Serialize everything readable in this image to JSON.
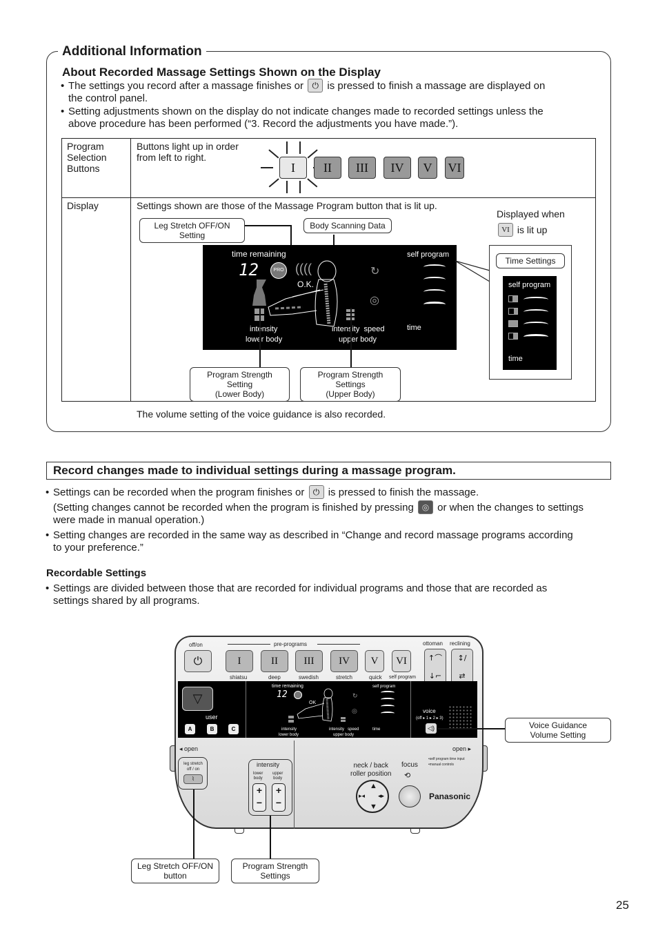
{
  "additional_info": {
    "title": "Additional Information",
    "subtitle": "About Recorded Massage Settings Shown on the Display",
    "bullets": [
      {
        "before": "The settings you record after a massage finishes or",
        "icon": "power-icon",
        "after": "is pressed to finish a massage are displayed on",
        "cont": "the control panel."
      },
      {
        "line1": "Setting adjustments shown on the display do not indicate changes made to recorded settings unless the",
        "line2": "above procedure has been performed (“3. Record the adjustments you have made.”)."
      }
    ],
    "table": {
      "rows": [
        {
          "label": [
            "Program",
            "Selection",
            "Buttons"
          ],
          "desc": [
            "Buttons light up in order",
            "from left to right."
          ]
        },
        {
          "label": [
            "Display"
          ],
          "desc": [
            "Settings shown are those of the Massage Program button that is lit up."
          ]
        }
      ],
      "program_buttons": [
        "I",
        "II",
        "III",
        "IV",
        "V",
        "VI"
      ],
      "lit_button_index": 0,
      "callouts": {
        "leg_stretch": "Leg Stretch OFF/ON Setting",
        "body_scan": "Body Scanning Data",
        "strength_lower": [
          "Program Strength Setting",
          "(Lower Body)"
        ],
        "strength_upper": [
          "Program Strength Settings",
          "(Upper Body)"
        ],
        "time_settings": "Time Settings"
      },
      "displayed_when": {
        "line1": "Displayed when",
        "button": "VI",
        "after": "is lit up"
      },
      "lcd": {
        "time_remaining": "time remaining",
        "time_value": "12",
        "pro": "PRO",
        "ok": "O.K.",
        "self_program": "self program",
        "intensity": "intensity",
        "lower_body": "lower body",
        "intensity_speed": "intensity  speed",
        "upper_body": "upper body",
        "time": "time"
      },
      "inset_lcd": {
        "self_program": "self program",
        "time": "time"
      }
    },
    "footnote": "The volume setting of the voice guidance is also recorded."
  },
  "record_section": {
    "title": "Record changes made to individual settings during a massage program.",
    "bullet1": {
      "before": "Settings can be recorded when the program finishes or",
      "after": "is pressed to finish the massage."
    },
    "paren": {
      "before": "(Setting changes cannot be recorded when the program is finished by pressing",
      "after": "or when the changes to settings",
      "cont": "were made in manual operation.)"
    },
    "bullet2": {
      "line1": "Setting changes are recorded in the same way as described in “Change and record massage programs according",
      "line2": "to your preference.”"
    },
    "recordable_title": "Recordable Settings",
    "bullet3": {
      "line1": "Settings are divided between those that are recorded for individual programs and those that are recorded as",
      "line2": "settings shared by all programs."
    }
  },
  "panel": {
    "off_on": "off/on",
    "pre_programs": "pre-programs",
    "buttons": [
      {
        "numeral": "I",
        "label": "shiatsu"
      },
      {
        "numeral": "II",
        "label": "deep"
      },
      {
        "numeral": "III",
        "label": "swedish"
      },
      {
        "numeral": "IV",
        "label": "stretch"
      },
      {
        "numeral": "V",
        "label": "quick"
      },
      {
        "numeral": "VI",
        "label": "self program"
      }
    ],
    "ottoman": "ottoman",
    "reclining": "reclining",
    "user": "user",
    "user_buttons": [
      "A",
      "B",
      "C"
    ],
    "lcd": {
      "time_remaining": "time remaining",
      "time_value": "12",
      "ok": "OK",
      "self_program": "self program",
      "intensity": "intensity",
      "lower_body": "lower body",
      "intensity_speed": "intensity   speed",
      "upper_body": "upper body",
      "time": "time"
    },
    "voice": "voice",
    "voice_cycle": "(off ▸ 1 ▸ 2 ▸ 3)",
    "open_left": "◂ open",
    "open_right": "open ▸",
    "open_notes": [
      "•self program time input",
      "•manual controls"
    ],
    "leg_stretch": [
      "leg stretch",
      "off / on"
    ],
    "intensity": "intensity",
    "lower_body": [
      "lower",
      "body"
    ],
    "upper_body": [
      "upper",
      "body"
    ],
    "plus": "+",
    "minus": "−",
    "neck_back": [
      "neck / back",
      "roller position"
    ],
    "focus": "focus",
    "brand": "Panasonic"
  },
  "panel_callouts": {
    "voice_volume": [
      "Voice Guidance",
      "Volume Setting"
    ],
    "leg_stretch_button": [
      "Leg Stretch OFF/ON",
      "button"
    ],
    "strength_settings": [
      "Program Strength",
      "Settings"
    ]
  },
  "page_number": "25"
}
